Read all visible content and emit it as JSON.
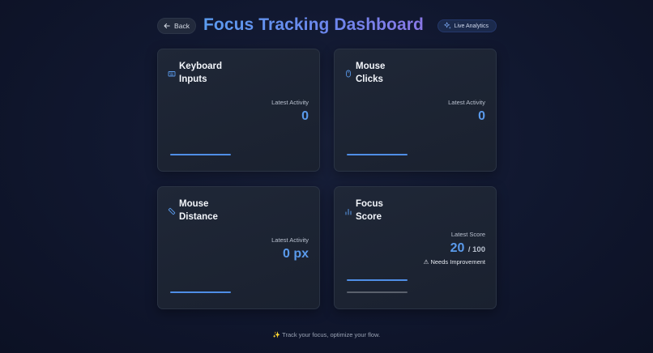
{
  "header": {
    "back_label": "Back",
    "title": "Focus Tracking Dashboard",
    "badge_label": "Live Analytics"
  },
  "cards": {
    "keyboard": {
      "title_line1": "Keyboard",
      "title_line2": "Inputs",
      "sub_label": "Latest Activity",
      "value": "0"
    },
    "clicks": {
      "title_line1": "Mouse",
      "title_line2": "Clicks",
      "sub_label": "Latest Activity",
      "value": "0"
    },
    "distance": {
      "title_line1": "Mouse",
      "title_line2": "Distance",
      "sub_label": "Latest Activity",
      "value": "0 px"
    },
    "focus": {
      "title_line1": "Focus",
      "title_line2": "Score",
      "sub_label": "Latest Score",
      "score": "20",
      "max": "/ 100",
      "status_icon": "⚠",
      "status": "Needs Improvement"
    }
  },
  "footer": {
    "icon": "✨",
    "text": "Track your focus, optimize your flow."
  },
  "colors": {
    "accent": "#5a9aeb",
    "background": "#111830",
    "card": "#1f2737"
  },
  "icons": [
    "arrow-left-icon",
    "sparkles-icon",
    "keyboard-icon",
    "mouse-icon",
    "ruler-icon",
    "bar-chart-icon"
  ]
}
